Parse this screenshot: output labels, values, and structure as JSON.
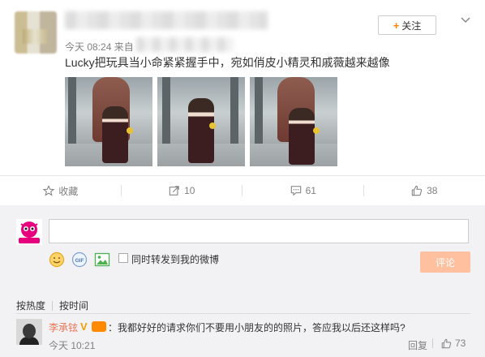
{
  "post": {
    "meta": "今天 08:24 来自",
    "text": "Lucky把玩具当小命紧紧握手中，宛如俏皮小精灵和戚薇越来越像",
    "follow_label": "关注",
    "follow_plus": "+",
    "photos": [
      "photo-1",
      "photo-2",
      "photo-3"
    ]
  },
  "actions": {
    "favorite_label": "收藏",
    "forward_count": "10",
    "comment_count": "61",
    "like_count": "38"
  },
  "composer": {
    "input_value": "",
    "forward_label": "同时转发到我的微博",
    "submit_label": "评论",
    "icons": [
      "emoji-icon",
      "gif-icon",
      "image-icon"
    ]
  },
  "sort": {
    "hot": "按热度",
    "time": "按时间"
  },
  "comment": {
    "name": "李承铉",
    "v_badge": "V",
    "text": "：我都好好的请求你们不要用小朋友的的照片，答应我以后还这样吗?",
    "time": "今天 10:21",
    "reply_label": "回复",
    "like_count": "73"
  },
  "colors": {
    "accent": "#ff8200",
    "name_link": "#eb7350",
    "submit_disabled": "#ffc09f",
    "composer_bg": "#f2f2f5"
  }
}
